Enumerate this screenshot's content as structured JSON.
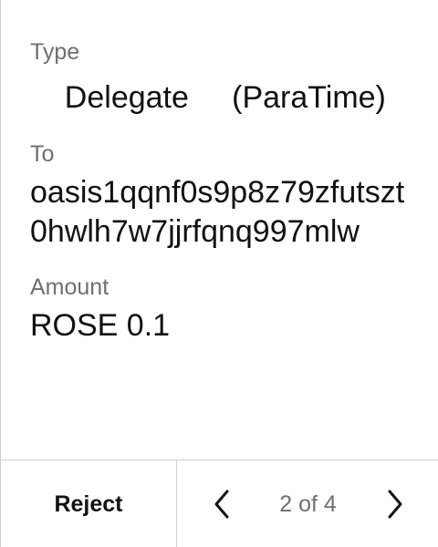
{
  "fields": {
    "type": {
      "label": "Type",
      "value": "    Delegate     (ParaTime)"
    },
    "to": {
      "label": "To",
      "value": "oasis1qqnf0s9p8z79zfutszt0hwlh7w7jjrfqnq997mlw"
    },
    "amount": {
      "label": "Amount",
      "value": "ROSE 0.1"
    }
  },
  "footer": {
    "reject_label": "Reject",
    "page_indicator": "2 of 4",
    "prev_icon": "chevron-left-icon",
    "next_icon": "chevron-right-icon"
  }
}
